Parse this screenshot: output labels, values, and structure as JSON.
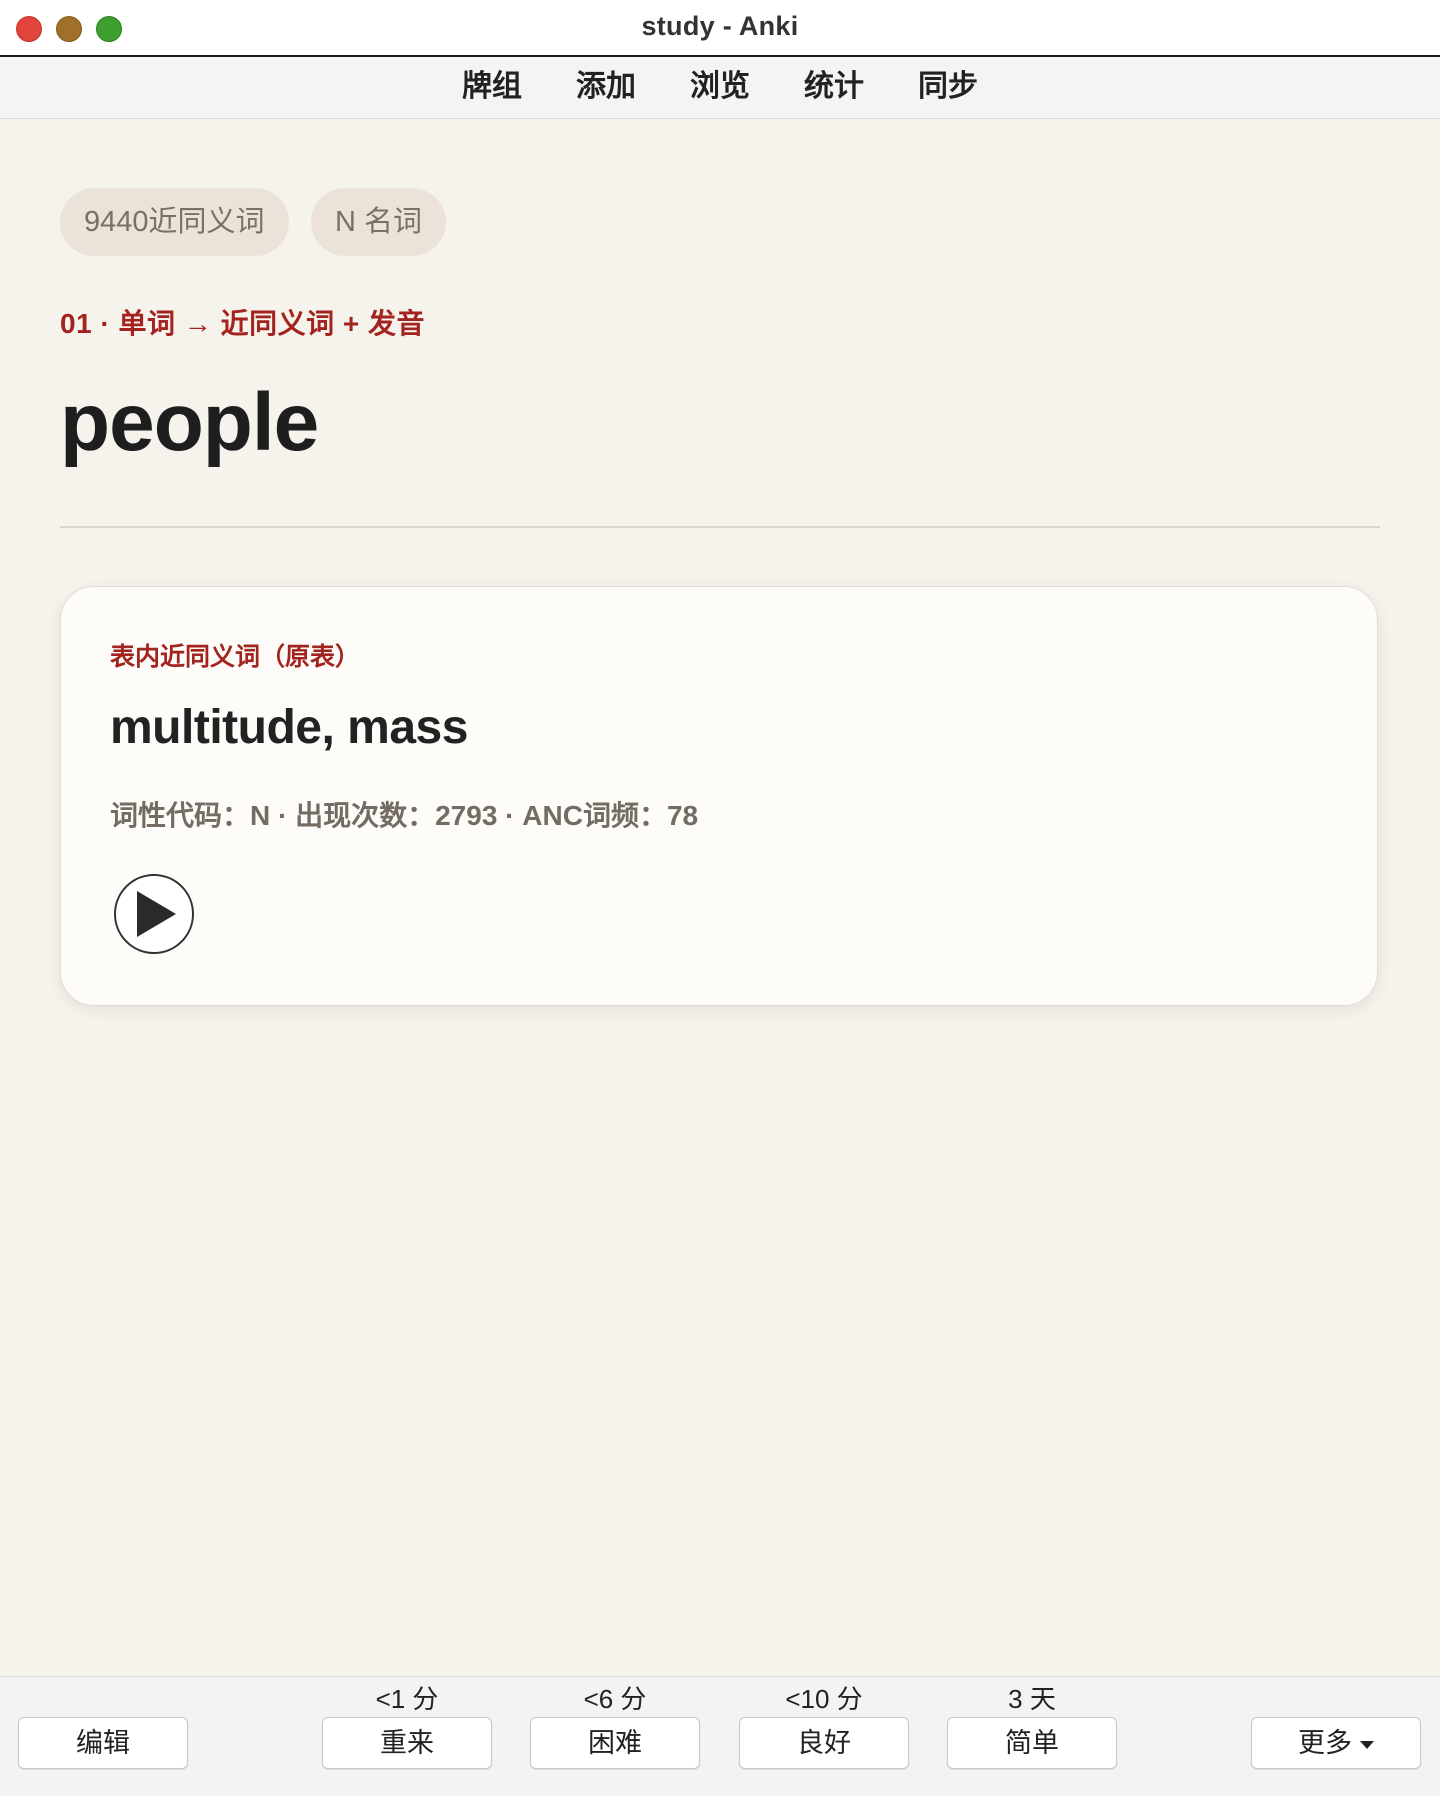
{
  "window": {
    "title": "study - Anki"
  },
  "topmenu": {
    "items": [
      "牌组",
      "添加",
      "浏览",
      "统计",
      "同步"
    ]
  },
  "card": {
    "tags": [
      "9440近同义词",
      "N 名词"
    ],
    "route": "01 · 单词 → 近同义词 + 发音",
    "word": "people",
    "synonym_box": {
      "label": "表内近同义词（原表）",
      "synonyms": "multitude, mass",
      "meta": "词性代码：N · 出现次数：2793 · ANC词频：78"
    }
  },
  "bottombar": {
    "edit_label": "编辑",
    "answers": [
      {
        "interval": "<1 分",
        "label": "重来"
      },
      {
        "interval": "<6 分",
        "label": "困难"
      },
      {
        "interval": "<10 分",
        "label": "良好"
      },
      {
        "interval": "3 天",
        "label": "简单"
      }
    ],
    "more_label": "更多"
  },
  "colors": {
    "accent_red": "#a3231f",
    "background": "#f6f2ec",
    "card": "#fdfcf8"
  }
}
